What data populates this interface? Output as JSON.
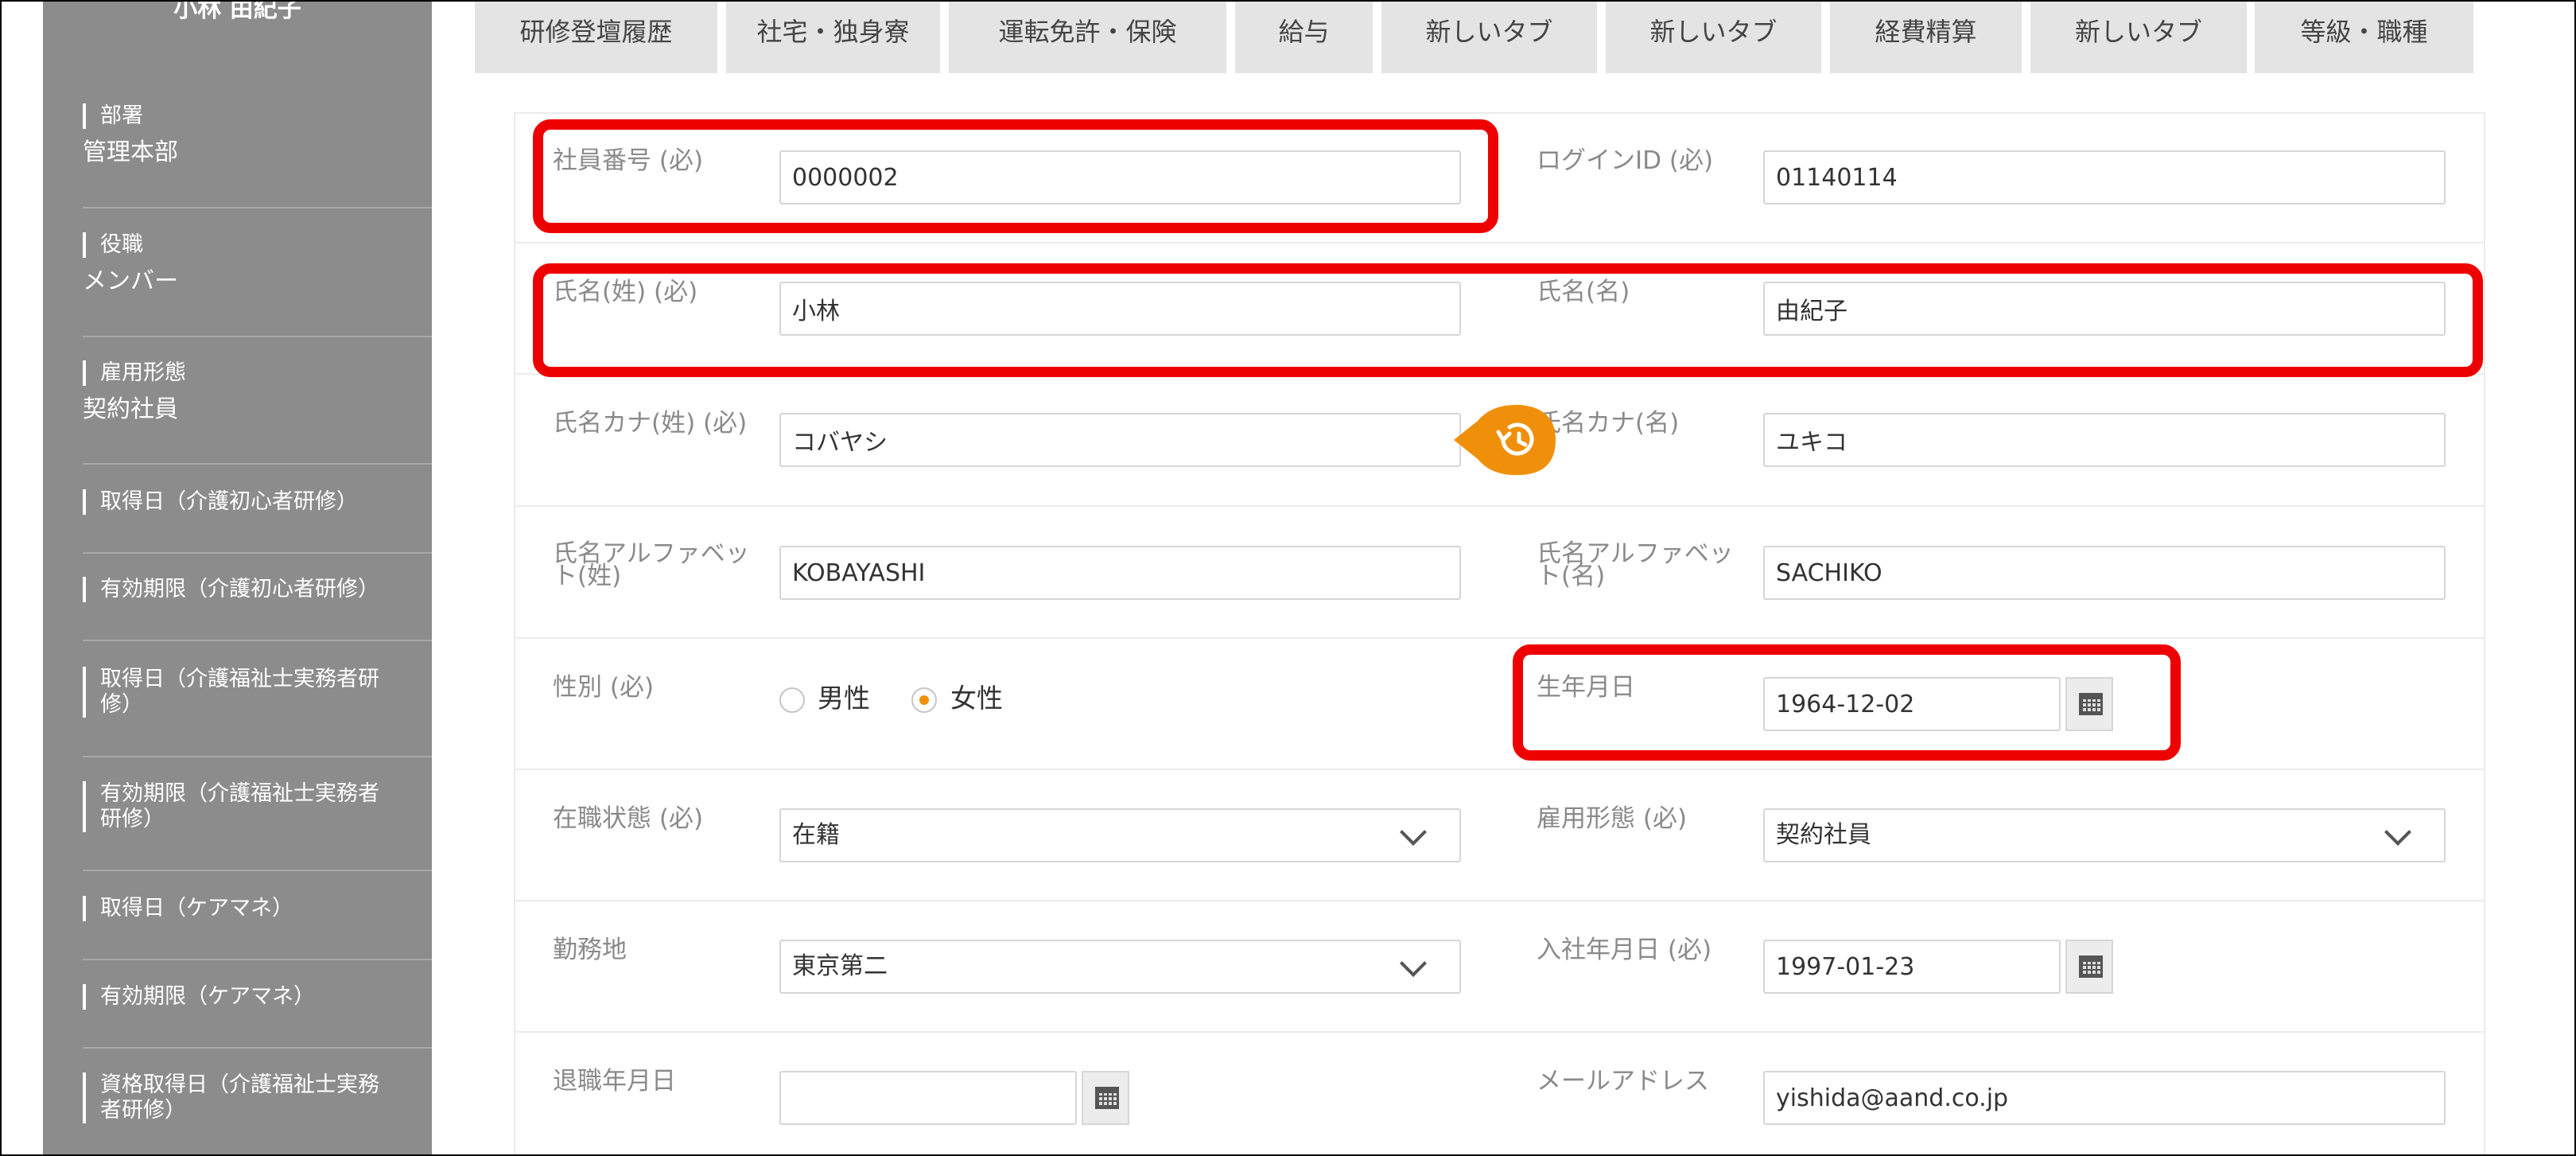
{
  "sidebar": {
    "name": "小林 由紀子",
    "items": [
      {
        "label": "部署",
        "value": "管理本部"
      },
      {
        "label": "役職",
        "value": "メンバー"
      },
      {
        "label": "雇用形態",
        "value": "契約社員"
      },
      {
        "label": "取得日（介護初心者研修）"
      },
      {
        "label": "有効期限（介護初心者研修）"
      },
      {
        "label": "取得日（介護福祉士実務者研修）"
      },
      {
        "label": "有効期限（介護福祉士実務者研修）"
      },
      {
        "label": "取得日（ケアマネ）"
      },
      {
        "label": "有効期限（ケアマネ）"
      },
      {
        "label": "資格取得日（介護福祉士実務者研修）"
      }
    ]
  },
  "tabs": [
    "研修登壇履歴",
    "社宅・独身寮",
    "運転免許・保険",
    "給与",
    "新しいタブ",
    "新しいタブ",
    "経費精算",
    "新しいタブ",
    "等級・職種"
  ],
  "form": {
    "employee_no": {
      "label": "社員番号 (必)",
      "value": "0000002"
    },
    "login_id": {
      "label": "ログインID (必)",
      "value": "01140114"
    },
    "last_name": {
      "label": "氏名(姓) (必)",
      "value": "小林"
    },
    "first_name": {
      "label": "氏名(名)",
      "value": "由紀子"
    },
    "last_kana": {
      "label": "氏名カナ(姓) (必)",
      "value": "コバヤシ"
    },
    "first_kana": {
      "label": "氏名カナ(名)",
      "value": "ユキコ"
    },
    "last_alpha": {
      "label_line1": "氏名アルファベッ",
      "label_line2": "ト(姓)",
      "value": "KOBAYASHI"
    },
    "first_alpha": {
      "label_line1": "氏名アルファベッ",
      "label_line2": "ト(名)",
      "value": "SACHIKO"
    },
    "gender": {
      "label": "性別 (必)",
      "options": [
        "男性",
        "女性"
      ],
      "selected": "女性"
    },
    "birthdate": {
      "label": "生年月日",
      "value": "1964-12-02"
    },
    "employment_status": {
      "label": "在職状態 (必)",
      "value": "在籍"
    },
    "employment_type": {
      "label": "雇用形態 (必)",
      "value": "契約社員"
    },
    "workplace": {
      "label": "勤務地",
      "value": "東京第二"
    },
    "hire_date": {
      "label": "入社年月日 (必)",
      "value": "1997-01-23"
    },
    "retire_date": {
      "label": "退職年月日",
      "value": ""
    },
    "email": {
      "label": "メールアドレス",
      "value": "yishida@aand.co.jp"
    }
  },
  "icons": {
    "history": "history-icon",
    "calendar": "calendar-icon",
    "chevron": "chevron-down-icon"
  },
  "colors": {
    "accent": "#f0900a",
    "highlight": "#ee0000",
    "sidebar_bg": "#8c8c8c"
  }
}
